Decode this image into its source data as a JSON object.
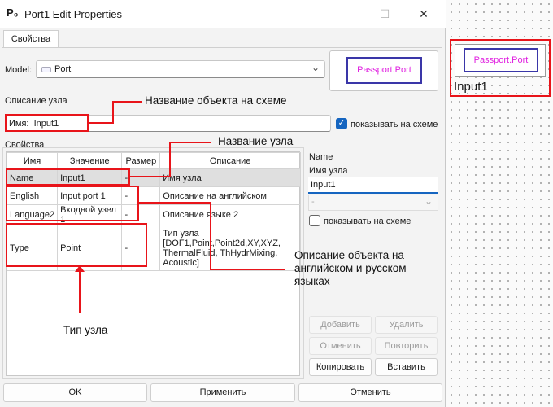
{
  "window": {
    "title": "Port1 Edit Properties",
    "app_icon_text": "P₀",
    "minimize": "—",
    "maximize": "☐",
    "close": "✕"
  },
  "tabs": [
    "Свойства"
  ],
  "model": {
    "label": "Model:",
    "value": "Port"
  },
  "preview": {
    "text": "Passport.Port"
  },
  "node_description_label": "Описание узла",
  "name_field": {
    "prefix": "Имя:",
    "value": "Input1"
  },
  "show_on_diagram": {
    "label": "показывать на схеме",
    "checked": true
  },
  "properties_group": "Свойства",
  "table": {
    "headers": [
      "Имя",
      "Значение",
      "Размер",
      "Описание"
    ],
    "rows": [
      {
        "name": "Name",
        "value": "Input1",
        "size": "-",
        "desc": "Имя узла"
      },
      {
        "name": "English",
        "value": "Input port 1",
        "size": "-",
        "desc": "Описание на английском"
      },
      {
        "name": "Language2",
        "value": "Входной узел 1",
        "size": "-",
        "desc": "Описание языке 2"
      },
      {
        "name": "Type",
        "value": "Point",
        "size": "-",
        "desc_lines": [
          "Тип узла",
          "[DOF1,Point,Point2d,XY,XYZ,",
          "ThermalFluid, ThHydrMixing,",
          "Acoustic]"
        ]
      }
    ]
  },
  "side_panel": {
    "title": "Name",
    "subtitle": "Имя узла",
    "input_value": "Input1",
    "combo_value": "-",
    "checkbox_label": "показывать на схеме",
    "checkbox_checked": false
  },
  "side_buttons": {
    "add": "Добавить",
    "delete": "Удалить",
    "undo": "Отменить",
    "redo": "Повторить",
    "copy": "Копировать",
    "paste": "Вставить"
  },
  "dialog_buttons": {
    "ok": "OK",
    "apply": "Применить",
    "cancel": "Отменить"
  },
  "annotations": {
    "object_name": "Название объекта на схеме",
    "node_name": "Название узла",
    "node_type": "Тип узла",
    "description": [
      "Описание объекта на",
      "английском и русском",
      "языках"
    ]
  },
  "canvas_node": {
    "box_text": "Passport.Port",
    "label": "Input1"
  },
  "colors": {
    "annotation": "#e8141a",
    "accent": "#1565c0",
    "port_border": "#3a36a8",
    "port_text": "#e020e0"
  }
}
